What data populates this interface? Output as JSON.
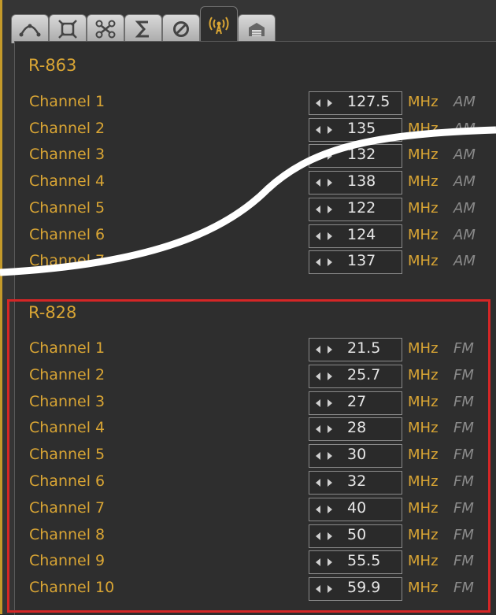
{
  "tabs": [
    {
      "icon": "curve-icon"
    },
    {
      "icon": "frame-icon"
    },
    {
      "icon": "drone-icon"
    },
    {
      "icon": "sigma-icon"
    },
    {
      "icon": "no-entry-icon"
    },
    {
      "icon": "radio-antenna-icon",
      "active": true
    },
    {
      "icon": "hangar-icon"
    }
  ],
  "radios": [
    {
      "title": "R-863",
      "channels": [
        {
          "label": "Channel 1",
          "value": "127.5",
          "unit": "MHz",
          "mode": "AM"
        },
        {
          "label": "Channel 2",
          "value": "135",
          "unit": "MHz",
          "mode": "AM"
        },
        {
          "label": "Channel 3",
          "value": "132",
          "unit": "MHz",
          "mode": "AM"
        },
        {
          "label": "Channel 4",
          "value": "138",
          "unit": "MHz",
          "mode": "AM"
        },
        {
          "label": "Channel 5",
          "value": "122",
          "unit": "MHz",
          "mode": "AM"
        },
        {
          "label": "Channel 6",
          "value": "124",
          "unit": "MHz",
          "mode": "AM"
        },
        {
          "label": "Channel 7",
          "value": "137",
          "unit": "MHz",
          "mode": "AM"
        }
      ]
    },
    {
      "title": "R-828",
      "channels": [
        {
          "label": "Channel 1",
          "value": "21.5",
          "unit": "MHz",
          "mode": "FM"
        },
        {
          "label": "Channel 2",
          "value": "25.7",
          "unit": "MHz",
          "mode": "FM"
        },
        {
          "label": "Channel 3",
          "value": "27",
          "unit": "MHz",
          "mode": "FM"
        },
        {
          "label": "Channel 4",
          "value": "28",
          "unit": "MHz",
          "mode": "FM"
        },
        {
          "label": "Channel 5",
          "value": "30",
          "unit": "MHz",
          "mode": "FM"
        },
        {
          "label": "Channel 6",
          "value": "32",
          "unit": "MHz",
          "mode": "FM"
        },
        {
          "label": "Channel 7",
          "value": "40",
          "unit": "MHz",
          "mode": "FM"
        },
        {
          "label": "Channel 8",
          "value": "50",
          "unit": "MHz",
          "mode": "FM"
        },
        {
          "label": "Channel 9",
          "value": "55.5",
          "unit": "MHz",
          "mode": "FM"
        },
        {
          "label": "Channel 10",
          "value": "59.9",
          "unit": "MHz",
          "mode": "FM"
        }
      ]
    }
  ],
  "colors": {
    "accent": "#d9a534",
    "highlight": "#d52626",
    "mode_text": "#8a8a8a"
  }
}
